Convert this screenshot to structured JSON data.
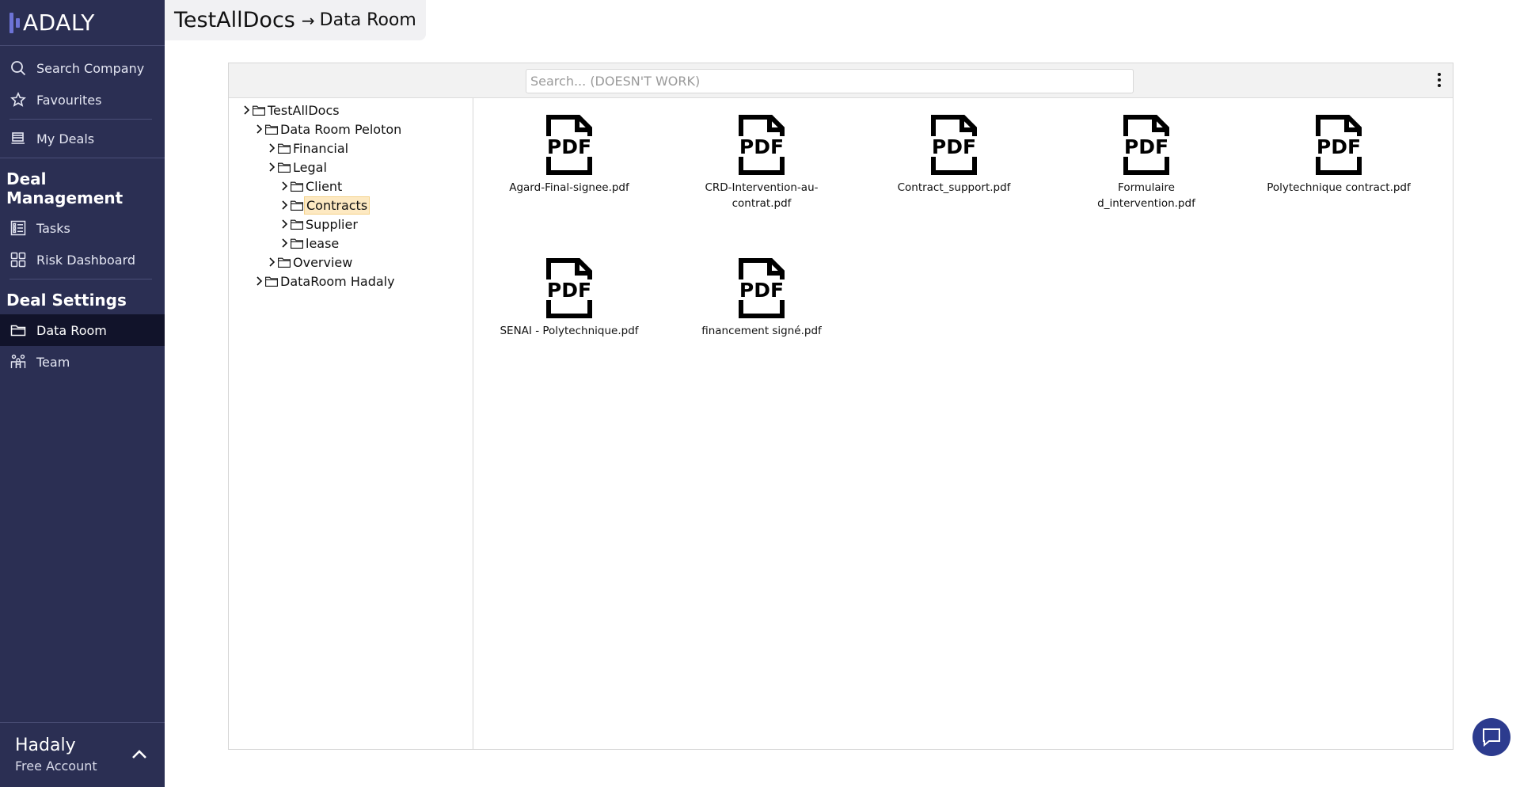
{
  "brand": {
    "logo_text": "ADALY"
  },
  "sidebar": {
    "top_items": [
      {
        "label": "Search Company",
        "icon": "search-icon"
      },
      {
        "label": "Favourites",
        "icon": "star-icon"
      },
      {
        "label": "My Deals",
        "icon": "deals-icon"
      }
    ],
    "deal_management": {
      "title": "Deal Management",
      "items": [
        {
          "label": "Tasks",
          "icon": "tasks-icon"
        },
        {
          "label": "Risk Dashboard",
          "icon": "dashboard-icon"
        }
      ]
    },
    "deal_settings": {
      "title": "Deal Settings",
      "items": [
        {
          "label": "Data Room",
          "icon": "folder-icon",
          "active": true
        },
        {
          "label": "Team",
          "icon": "team-icon"
        }
      ]
    },
    "account": {
      "name": "Hadaly",
      "plan": "Free Account"
    }
  },
  "header": {
    "title": "TestAllDocs",
    "arrow": "→",
    "subtitle": "Data Room"
  },
  "dataroom": {
    "search_placeholder": "Search... (DOESN'T WORK)",
    "tree": [
      {
        "label": "TestAllDocs",
        "depth": 0
      },
      {
        "label": "Data Room Peloton",
        "depth": 1
      },
      {
        "label": "Financial",
        "depth": 2
      },
      {
        "label": "Legal",
        "depth": 2
      },
      {
        "label": "Client",
        "depth": 3
      },
      {
        "label": "Contracts",
        "depth": 3,
        "selected": true
      },
      {
        "label": "Supplier",
        "depth": 3
      },
      {
        "label": "lease",
        "depth": 3
      },
      {
        "label": "Overview",
        "depth": 2
      },
      {
        "label": "DataRoom Hadaly",
        "depth": 1
      }
    ],
    "files": [
      {
        "name_line1": "Agard-Final-signee.pdf",
        "name_line2": ""
      },
      {
        "name_line1": "CRD-Intervention-au-",
        "name_line2": "contrat.pdf"
      },
      {
        "name_line1": "Contract_support.pdf",
        "name_line2": ""
      },
      {
        "name_line1": "Formulaire",
        "name_line2": "d_intervention.pdf"
      },
      {
        "name_line1": "Polytechnique contract.pdf",
        "name_line2": ""
      },
      {
        "name_line1": "SENAI - Polytechnique.pdf",
        "name_line2": ""
      },
      {
        "name_line1": "financement signé.pdf",
        "name_line2": ""
      }
    ],
    "file_icon_text": "PDF"
  }
}
